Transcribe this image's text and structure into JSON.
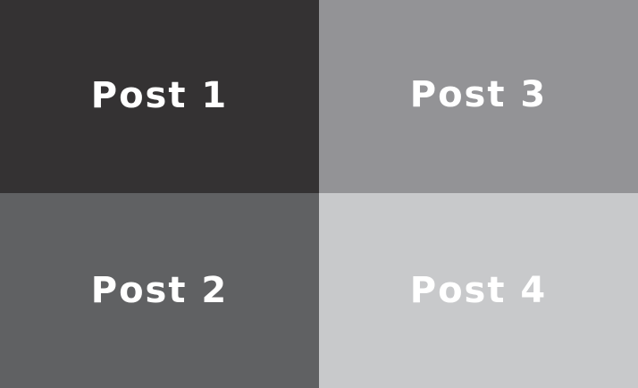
{
  "posts": [
    {
      "label": "Post 1",
      "color": "#343233"
    },
    {
      "label": "Post 3",
      "color": "#939396"
    },
    {
      "label": "Post 2",
      "color": "#606163"
    },
    {
      "label": "Post 4",
      "color": "#c8c9cb"
    }
  ]
}
